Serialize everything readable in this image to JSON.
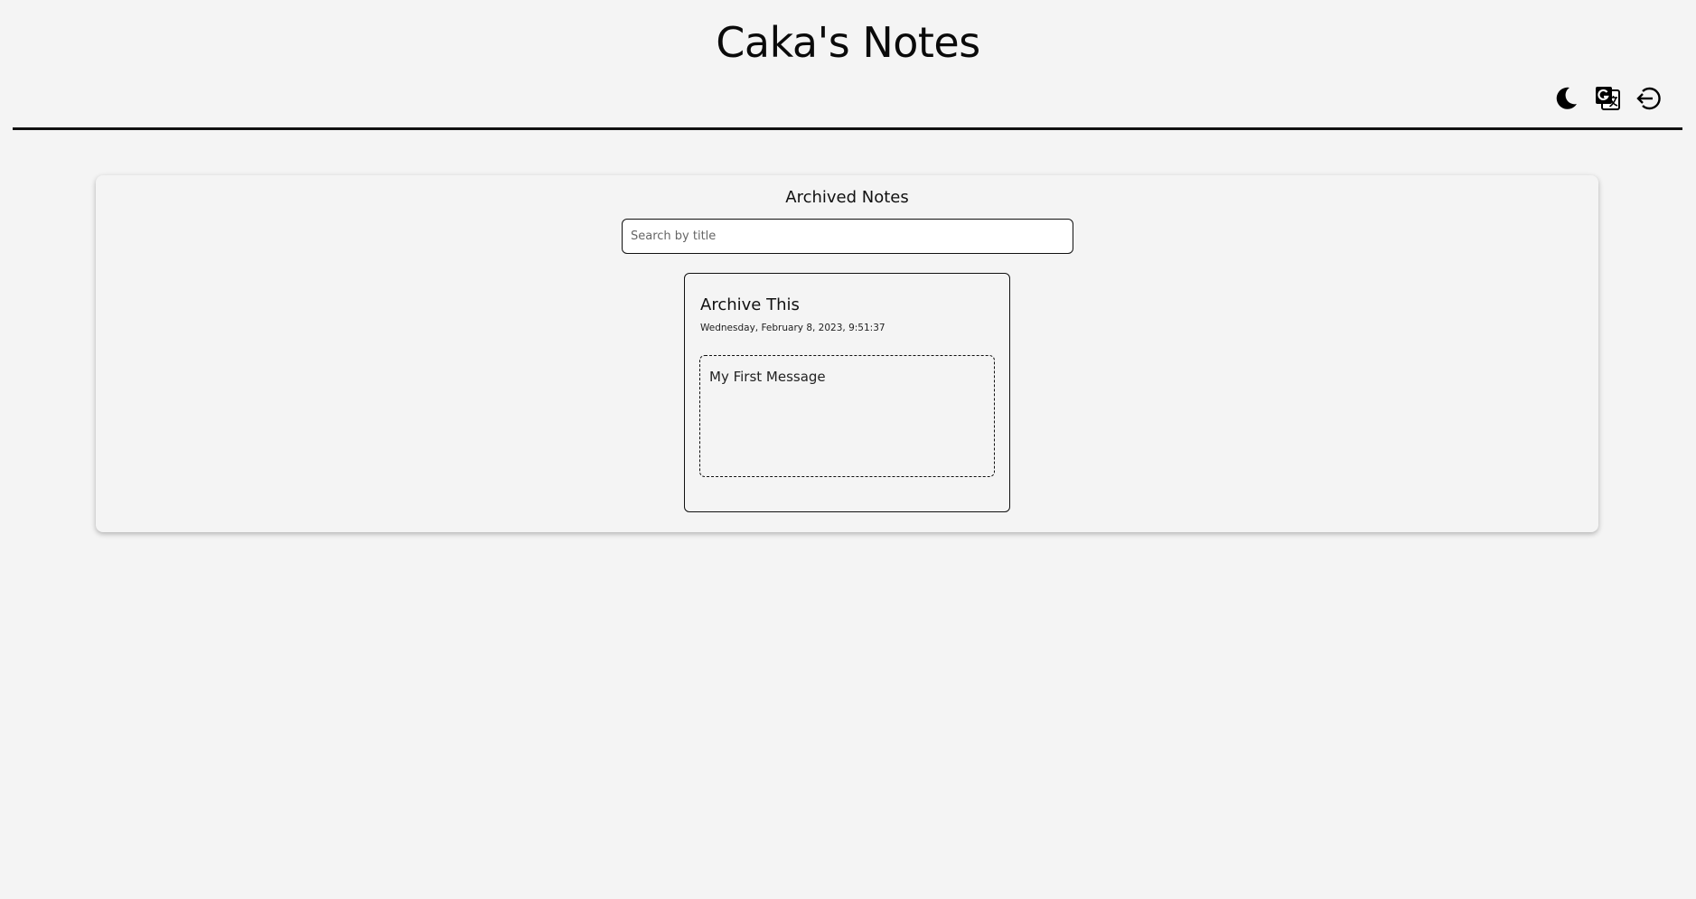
{
  "header": {
    "title": "Caka's Notes",
    "actions": [
      {
        "name": "theme-toggle",
        "icon": "moon-icon"
      },
      {
        "name": "language-toggle",
        "icon": "translate-icon"
      },
      {
        "name": "logout",
        "icon": "logout-icon"
      }
    ]
  },
  "archive": {
    "heading": "Archived Notes",
    "search": {
      "placeholder": "Search by title",
      "value": ""
    },
    "notes": [
      {
        "title": "Archive This",
        "date": "Wednesday, February 8, 2023, 9:51:37",
        "body": "My First Message"
      }
    ]
  },
  "colors": {
    "background": "#f4f4f4",
    "text": "#111111",
    "accent": "#000000"
  }
}
